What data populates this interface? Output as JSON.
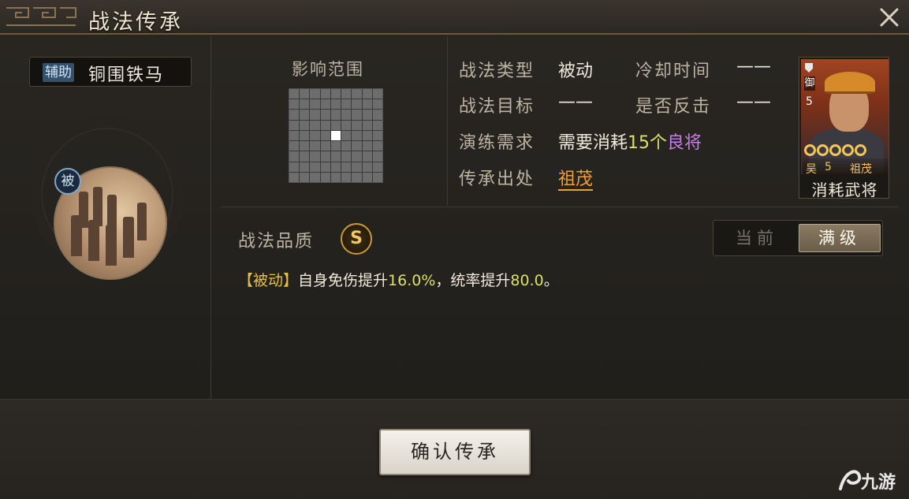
{
  "window": {
    "title": "战法传承"
  },
  "skill": {
    "type_tag": "辅助",
    "name": "铜围铁马",
    "badge": "被"
  },
  "range": {
    "label": "影响范围",
    "grid_size": 9,
    "highlight_row": 5,
    "highlight_col": 5
  },
  "info": {
    "type_label": "战法类型",
    "type_value": "被动",
    "cooldown_label": "冷却时间",
    "cooldown_value": "——",
    "target_label": "战法目标",
    "target_value": "——",
    "counter_label": "是否反击",
    "counter_value": "——",
    "train_label": "演练需求",
    "train_prefix": "需要消耗",
    "train_count": "15个",
    "train_quality": "良将",
    "source_label": "传承出处",
    "source_value": "祖茂"
  },
  "hero_card": {
    "class_label": "御",
    "cost": "5",
    "faction": "吴",
    "level": "5",
    "name": "祖茂",
    "stars": 5,
    "caption": "消耗武将"
  },
  "quality": {
    "label": "战法品质",
    "grade": "S"
  },
  "toggle": {
    "current": "当前",
    "max": "满级"
  },
  "effect": {
    "tag": "【被动】",
    "text_1": "自身免伤提升",
    "value_1": "16.0%",
    "text_2": "，统率提升",
    "value_2": "80.0",
    "text_3": "。"
  },
  "actions": {
    "confirm": "确认传承"
  },
  "watermark": {
    "text": "九游"
  },
  "colors": {
    "accent_gold": "#f0c864",
    "highlight_green": "#d8e06a",
    "quality_purple": "#c57ee8",
    "link_orange": "#f0a030"
  }
}
